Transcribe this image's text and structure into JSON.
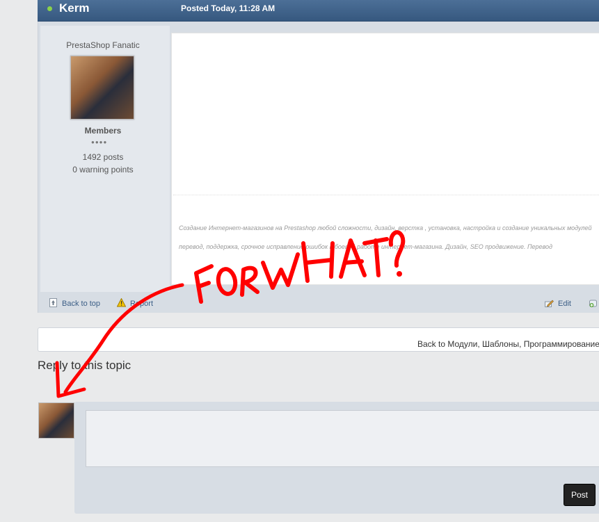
{
  "post": {
    "author_name": "Kerm",
    "posted_date": "Posted Today, 11:28 AM",
    "author_title": "PrestaShop Fanatic",
    "group": "Members",
    "pips": "●●●●",
    "post_count": "1492 posts",
    "warning_points": "0 warning points",
    "signature_lines": [
      "Создание Интернет-магазинов на Prestashop любой сложности, дизайн, верстка , установка, настройка и создание уникальных модулей",
      "перевод, поддержка, срочное исправление ошибок в боевой работе интернет-магазина. Дизайн, SEO продвижение. Перевод"
    ],
    "controls": {
      "back_to_top": "Back to top",
      "report": "Report",
      "edit": "Edit"
    }
  },
  "back_link": "Back to Модули, Шаблоны, Программирование",
  "reply": {
    "heading": "Reply to this topic",
    "post_button": "Post"
  },
  "annotation": {
    "text": "FORWHAT?",
    "color": "#ff0000"
  }
}
